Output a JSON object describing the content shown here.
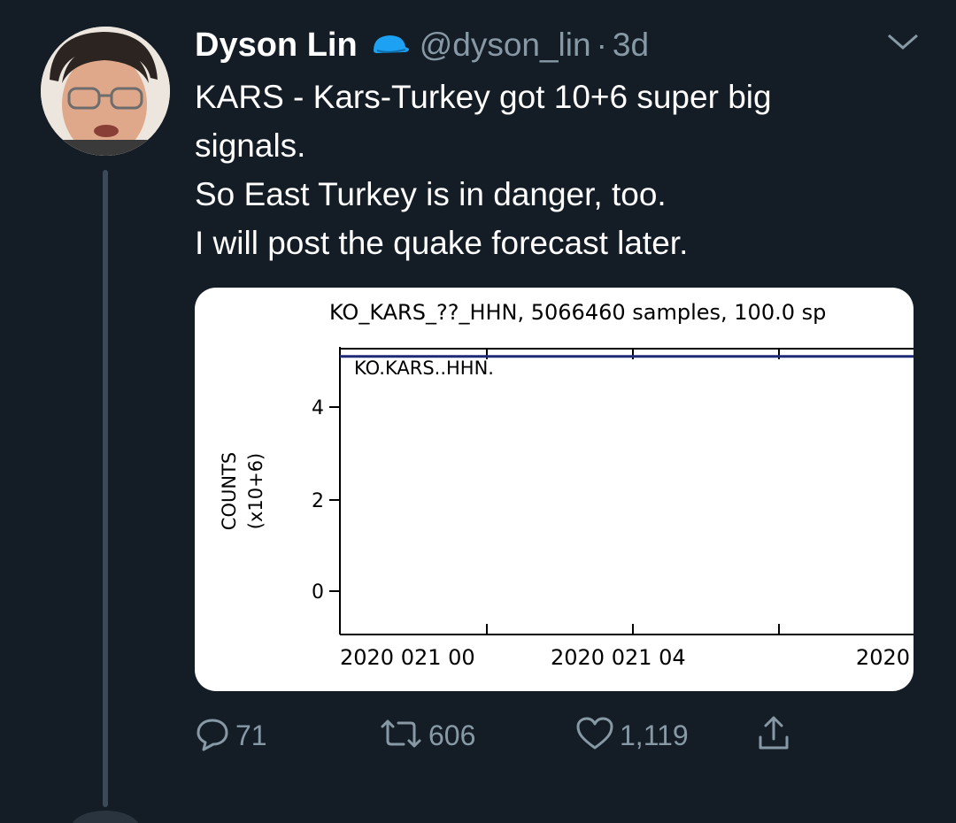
{
  "tweet": {
    "author_name": "Dyson Lin",
    "handle": "@dyson_lin",
    "separator": "·",
    "time": "3d",
    "lines": [
      "KARS - Kars-Turkey got 10+6 super big",
      "signals.",
      "So East Turkey is in danger, too.",
      "I will post the quake forecast later."
    ]
  },
  "icons": {
    "verified": "blue-cap-icon",
    "menu": "chevron-down-icon",
    "reply": "reply-icon",
    "retweet": "retweet-icon",
    "like": "heart-icon",
    "share": "share-icon"
  },
  "actions": {
    "replies": "71",
    "retweets": "606",
    "likes": "1,119"
  },
  "colors": {
    "background": "#141d26",
    "secondary_text": "#8899a6",
    "verified_blue": "#1da1f2",
    "plot_trace": "#1e2a78"
  },
  "chart_data": {
    "type": "line",
    "title": "KO_KARS_??_HHN, 5066460 samples, 100.0 sp",
    "trace_label": "KO.KARS..HHN.",
    "ylabel_line1": "COUNTS",
    "ylabel_line2": "(x10+6)",
    "yticks": [
      {
        "value": 4,
        "label": "4"
      },
      {
        "value": 2,
        "label": "2"
      },
      {
        "value": 0,
        "label": "0"
      }
    ],
    "ylim": [
      -0.9,
      5.1
    ],
    "xtick_labels": [
      "2020 021 00",
      "2020 021 04",
      "2020"
    ],
    "series": [
      {
        "x": [
          0,
          1
        ],
        "values": [
          5.1,
          5.1
        ]
      }
    ]
  }
}
